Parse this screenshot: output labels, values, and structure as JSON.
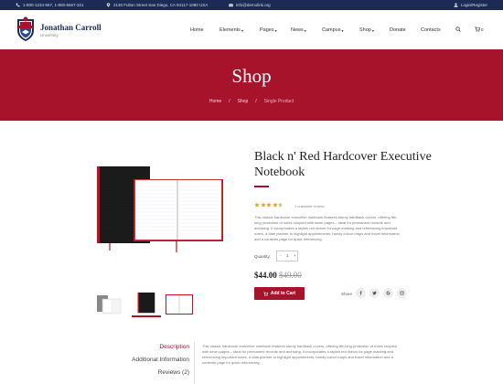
{
  "topbar": {
    "phones": "1-800-1234-567, 1-800-6567-321",
    "address": "2130 Fulton Street San Diego, CA 94117-1080 USA",
    "email": "info@demolink.org",
    "login": "Login/Register"
  },
  "brand": {
    "name": "Jonathan Carroll",
    "subtitle": "University"
  },
  "nav": {
    "items": [
      "Home",
      "Elements",
      "Pages",
      "News",
      "Campus",
      "Shop",
      "Donate",
      "Contacts"
    ],
    "cart_count": "0"
  },
  "hero": {
    "title": "Shop",
    "breadcrumbs": [
      "Home",
      "Shop",
      "Single Product"
    ],
    "separator": "/"
  },
  "product": {
    "title": "Black n' Red Hardcover Executive Notebook",
    "rating": 4.5,
    "rating_max": 5,
    "review_text": "1 customer review",
    "description": "This classic hardcover executive notebook features sturdy hardback covers, offering life-long protection of notes coupled with sewn pages – ideal for permanent records and archiving. It incorporates a stylish red ribbon for page marking and referencing important notes, a date planner to highlight appointments, handy colour maps and travel information and a contents page for quick referencing.",
    "quantity_label": "Quantity:",
    "quantity": "1",
    "minus": "-",
    "plus": "+",
    "price": "$44.00",
    "old_price": "$49.00",
    "add_to_cart": "Add to Cart",
    "share_label": "Share",
    "share_icons": [
      "facebook-icon",
      "twitter-icon",
      "google-icon",
      "instagram-icon"
    ]
  },
  "tabs": {
    "items": [
      "Description",
      "Additional Information",
      "Reviews (2)"
    ],
    "active": "Description",
    "description_text": "This classic hardcover executive notebook features sturdy hardback covers, offering life-long protection of notes coupled with sewn pages – ideal for permanent records and archiving. It incorporates a stylish red ribbon for page marking and referencing important notes, a date planner to highlight appointments, handy colour maps and travel information and a contents page for quick referencing."
  },
  "colors": {
    "accent": "#a6132b",
    "topbar": "#1c2a55",
    "brand": "#1c2a55"
  }
}
